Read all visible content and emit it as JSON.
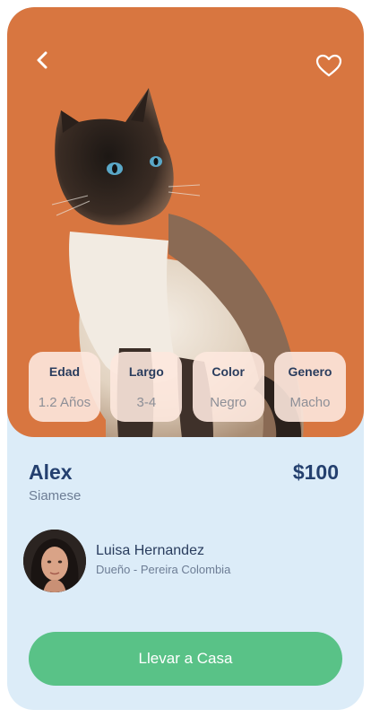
{
  "colors": {
    "hero_bg": "#d87640",
    "card_bg": "#dcecf8",
    "accent_green": "#59c287",
    "text_dark": "#24406f",
    "text_muted": "#6d7d95"
  },
  "header": {
    "back_icon": "chevron-left-icon",
    "favorite_icon": "heart-outline-icon"
  },
  "stats": [
    {
      "label": "Edad",
      "value": "1.2 Años"
    },
    {
      "label": "Largo",
      "value": "3-4"
    },
    {
      "label": "Color",
      "value": "Negro"
    },
    {
      "label": "Genero",
      "value": "Macho"
    }
  ],
  "pet": {
    "name": "Alex",
    "breed": "Siamese",
    "price": "$100"
  },
  "owner": {
    "name": "Luisa Hernandez",
    "location": "Dueño - Pereira Colombia"
  },
  "cta": {
    "label": "Llevar a Casa"
  }
}
